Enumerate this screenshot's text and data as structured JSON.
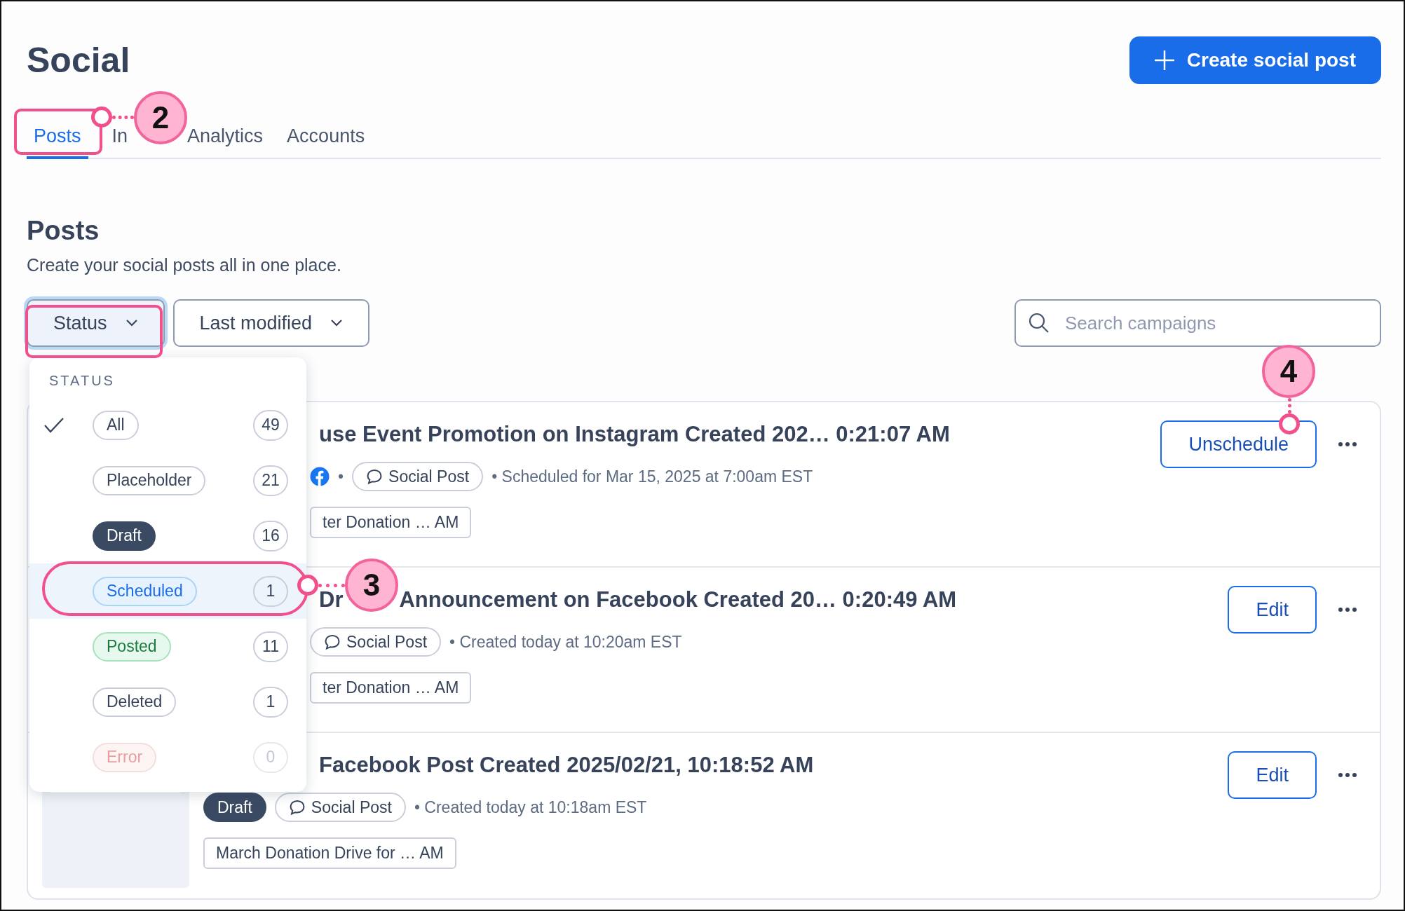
{
  "page": {
    "title": "Social",
    "create_button": "Create social post"
  },
  "tabs": [
    {
      "label": "Posts",
      "selected": true
    },
    {
      "label": "In",
      "selected": false
    },
    {
      "label": "Analytics",
      "selected": false
    },
    {
      "label": "Accounts",
      "selected": false
    }
  ],
  "section": {
    "heading": "Posts",
    "subtitle": "Create your social posts all in one place."
  },
  "filters": [
    {
      "label": "Status",
      "active": true
    },
    {
      "label": "Last modified",
      "active": false
    }
  ],
  "search": {
    "placeholder": "Search campaigns"
  },
  "status_menu": {
    "heading": "STATUS",
    "items": [
      {
        "label": "All",
        "count": "49",
        "kind": "neutral",
        "checked": true,
        "selected": false
      },
      {
        "label": "Placeholder",
        "count": "21",
        "kind": "neutral",
        "checked": false,
        "selected": false
      },
      {
        "label": "Draft",
        "count": "16",
        "kind": "draft",
        "checked": false,
        "selected": false
      },
      {
        "label": "Scheduled",
        "count": "1",
        "kind": "scheduled",
        "checked": false,
        "selected": true
      },
      {
        "label": "Posted",
        "count": "11",
        "kind": "posted",
        "checked": false,
        "selected": false
      },
      {
        "label": "Deleted",
        "count": "1",
        "kind": "neutral",
        "checked": false,
        "selected": false
      },
      {
        "label": "Error",
        "count": "0",
        "kind": "error",
        "checked": false,
        "selected": false
      }
    ]
  },
  "posts": [
    {
      "title_parts": [
        "use Event Promotion on Instagram Created 202…  0:21:07 AM"
      ],
      "icons": [
        {
          "kind": "facebook",
          "separator": "•"
        }
      ],
      "type": "Social Post",
      "info": "•  Scheduled for Mar 15, 2025 at 7:00am EST",
      "tag": "ter Donation …  AM",
      "action": "Unschedule"
    },
    {
      "title_parts": [
        "Dr",
        "Announcement on Facebook Created 20…  0:20:49 AM"
      ],
      "type": "Social Post",
      "info": "•  Created today at 10:20am EST",
      "tag": "ter Donation …  AM",
      "action": "Edit"
    },
    {
      "title_parts": [
        "Facebook Post Created 2025/02/21, 10:18:52 AM"
      ],
      "thumbnail": {
        "kind": "picture"
      },
      "status": {
        "label": "Draft",
        "kind": "draft"
      },
      "type": "Social Post",
      "info": "•  Created today at 10:18am EST",
      "tag": "March Donation Drive for …  AM",
      "action": "Edit"
    }
  ],
  "annotations": [
    {
      "number": "2"
    },
    {
      "number": "3"
    },
    {
      "number": "4"
    }
  ]
}
